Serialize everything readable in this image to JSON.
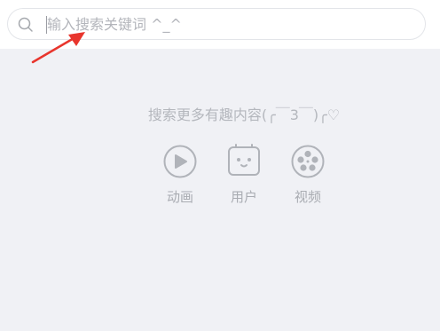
{
  "search": {
    "placeholder": "输入搜索关键词 ^_^"
  },
  "empty_state": {
    "message": "搜索更多有趣内容(╭￣3￣)╭♡"
  },
  "quick_links": [
    {
      "label": "动画",
      "icon": "play-circle-icon"
    },
    {
      "label": "用户",
      "icon": "tv-face-icon"
    },
    {
      "label": "视频",
      "icon": "film-reel-icon"
    }
  ],
  "colors": {
    "background": "#f0f1f5",
    "icon_gray": "#b0b3b9",
    "annotation_red": "#e8352d"
  }
}
